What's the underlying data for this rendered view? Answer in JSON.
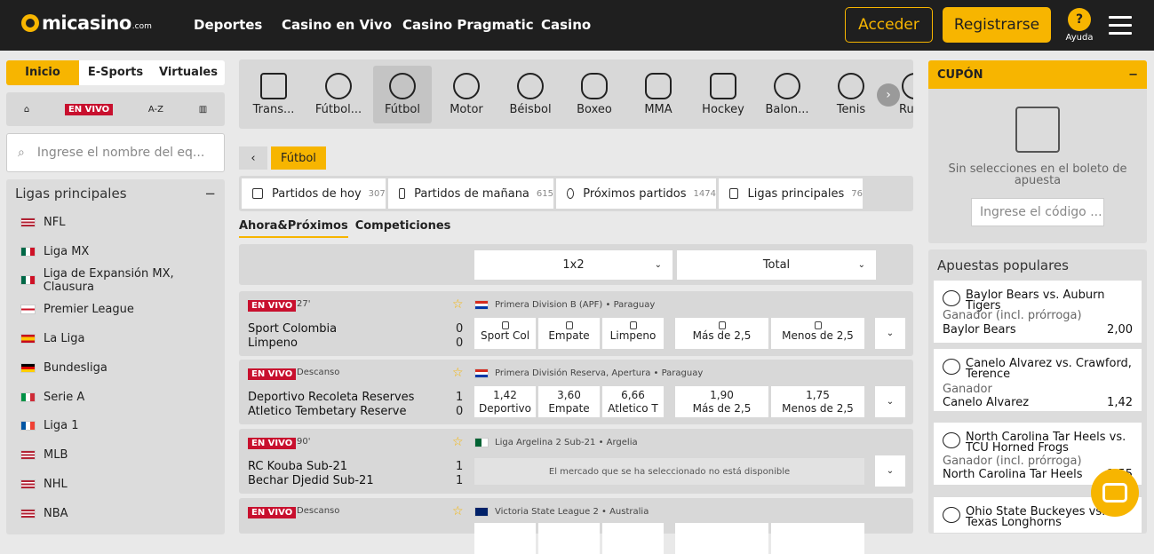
{
  "header": {
    "logo": "micasino",
    "logo_suffix": ".com",
    "nav": [
      "Deportes",
      "Casino en Vivo",
      "Casino Pragmatic",
      "Casino"
    ],
    "login": "Acceder",
    "register": "Registrarse",
    "help": "Ayuda"
  },
  "left": {
    "tabs": [
      "Inicio",
      "E-Sports",
      "Virtuales"
    ],
    "live_badge": "EN VIVO",
    "az": "A-Z",
    "search_placeholder": "Ingrese el nombre del eq...",
    "leagues_title": "Ligas principales",
    "leagues": [
      "NFL",
      "Liga MX",
      "Liga de Expansión MX, Clausura",
      "Premier League",
      "La Liga",
      "Bundesliga",
      "Serie A",
      "Liga 1",
      "MLB",
      "NHL",
      "NBA"
    ]
  },
  "sports": [
    "Trans...",
    "Fútbol...",
    "Fútbol",
    "Motor",
    "Béisbol",
    "Boxeo",
    "MMA",
    "Hockey",
    "Balon...",
    "Tenis",
    "Ru"
  ],
  "breadcrumb": "Fútbol",
  "filters": [
    {
      "label": "Partidos de hoy",
      "count": "307"
    },
    {
      "label": "Partidos de mañana",
      "count": "615"
    },
    {
      "label": "Próximos partidos",
      "count": "1474"
    },
    {
      "label": "Ligas principales",
      "count": "76"
    }
  ],
  "subtabs": [
    "Ahora&Próximos",
    "Competiciones"
  ],
  "selects": [
    "1x2",
    "Total"
  ],
  "matches": [
    {
      "badge": "EN VIVO",
      "time": "27'",
      "league": "Primera Division B (APF) • Paraguay",
      "home": "Sport Colombia",
      "away": "Limpeno",
      "hs": "0",
      "as": "0",
      "odds": [
        {
          "v": "",
          "l": "Sport Col"
        },
        {
          "v": "",
          "l": "Empate"
        },
        {
          "v": "",
          "l": "Limpeno"
        },
        {
          "v": "",
          "l": "Más de 2,5"
        },
        {
          "v": "",
          "l": "Menos de 2,5"
        }
      ],
      "locked": true
    },
    {
      "badge": "EN VIVO",
      "time": "Descanso",
      "league": "Primera División Reserva, Apertura • Paraguay",
      "home": "Deportivo Recoleta Reserves",
      "away": "Atletico Tembetary Reserve",
      "hs": "1",
      "as": "0",
      "odds": [
        {
          "v": "1,42",
          "l": "Deportivo"
        },
        {
          "v": "3,60",
          "l": "Empate"
        },
        {
          "v": "6,66",
          "l": "Atletico T"
        },
        {
          "v": "1,90",
          "l": "Más de 2,5"
        },
        {
          "v": "1,75",
          "l": "Menos de 2,5"
        }
      ],
      "locked": false
    },
    {
      "badge": "EN VIVO",
      "time": "90'",
      "league": "Liga Argelina 2 Sub-21 • Argelia",
      "home": "RC Kouba Sub-21",
      "away": "Bechar Djedid Sub-21",
      "hs": "1",
      "as": "1",
      "unavailable": "El mercado que se ha seleccionado no está disponible"
    },
    {
      "badge": "EN VIVO",
      "time": "Descanso",
      "league": "Victoria State League 2 • Australia"
    }
  ],
  "coupon": {
    "title": "CUPÓN",
    "empty": "Sin selecciones en el boleto de apuesta",
    "code_placeholder": "Ingrese el código ..."
  },
  "popular": {
    "title": "Apuestas populares",
    "items": [
      {
        "event": "Baylor Bears vs. Auburn Tigers",
        "market": "Ganador (incl. prórroga)",
        "pick": "Baylor Bears",
        "odd": "2,00"
      },
      {
        "event": "Canelo Alvarez vs. Crawford, Terence",
        "market": "Ganador",
        "pick": "Canelo Alvarez",
        "odd": "1,42"
      },
      {
        "event": "North Carolina Tar Heels vs. TCU Horned Frogs",
        "market": "Ganador (incl. prórroga)",
        "pick": "North Carolina Tar Heels",
        "odd": "1,55"
      },
      {
        "event": "Ohio State Buckeyes vs. Texas Longhorns"
      }
    ]
  },
  "colors": {
    "accent": "#f7b500",
    "header": "#1f1f1f",
    "live": "#c8102e"
  }
}
